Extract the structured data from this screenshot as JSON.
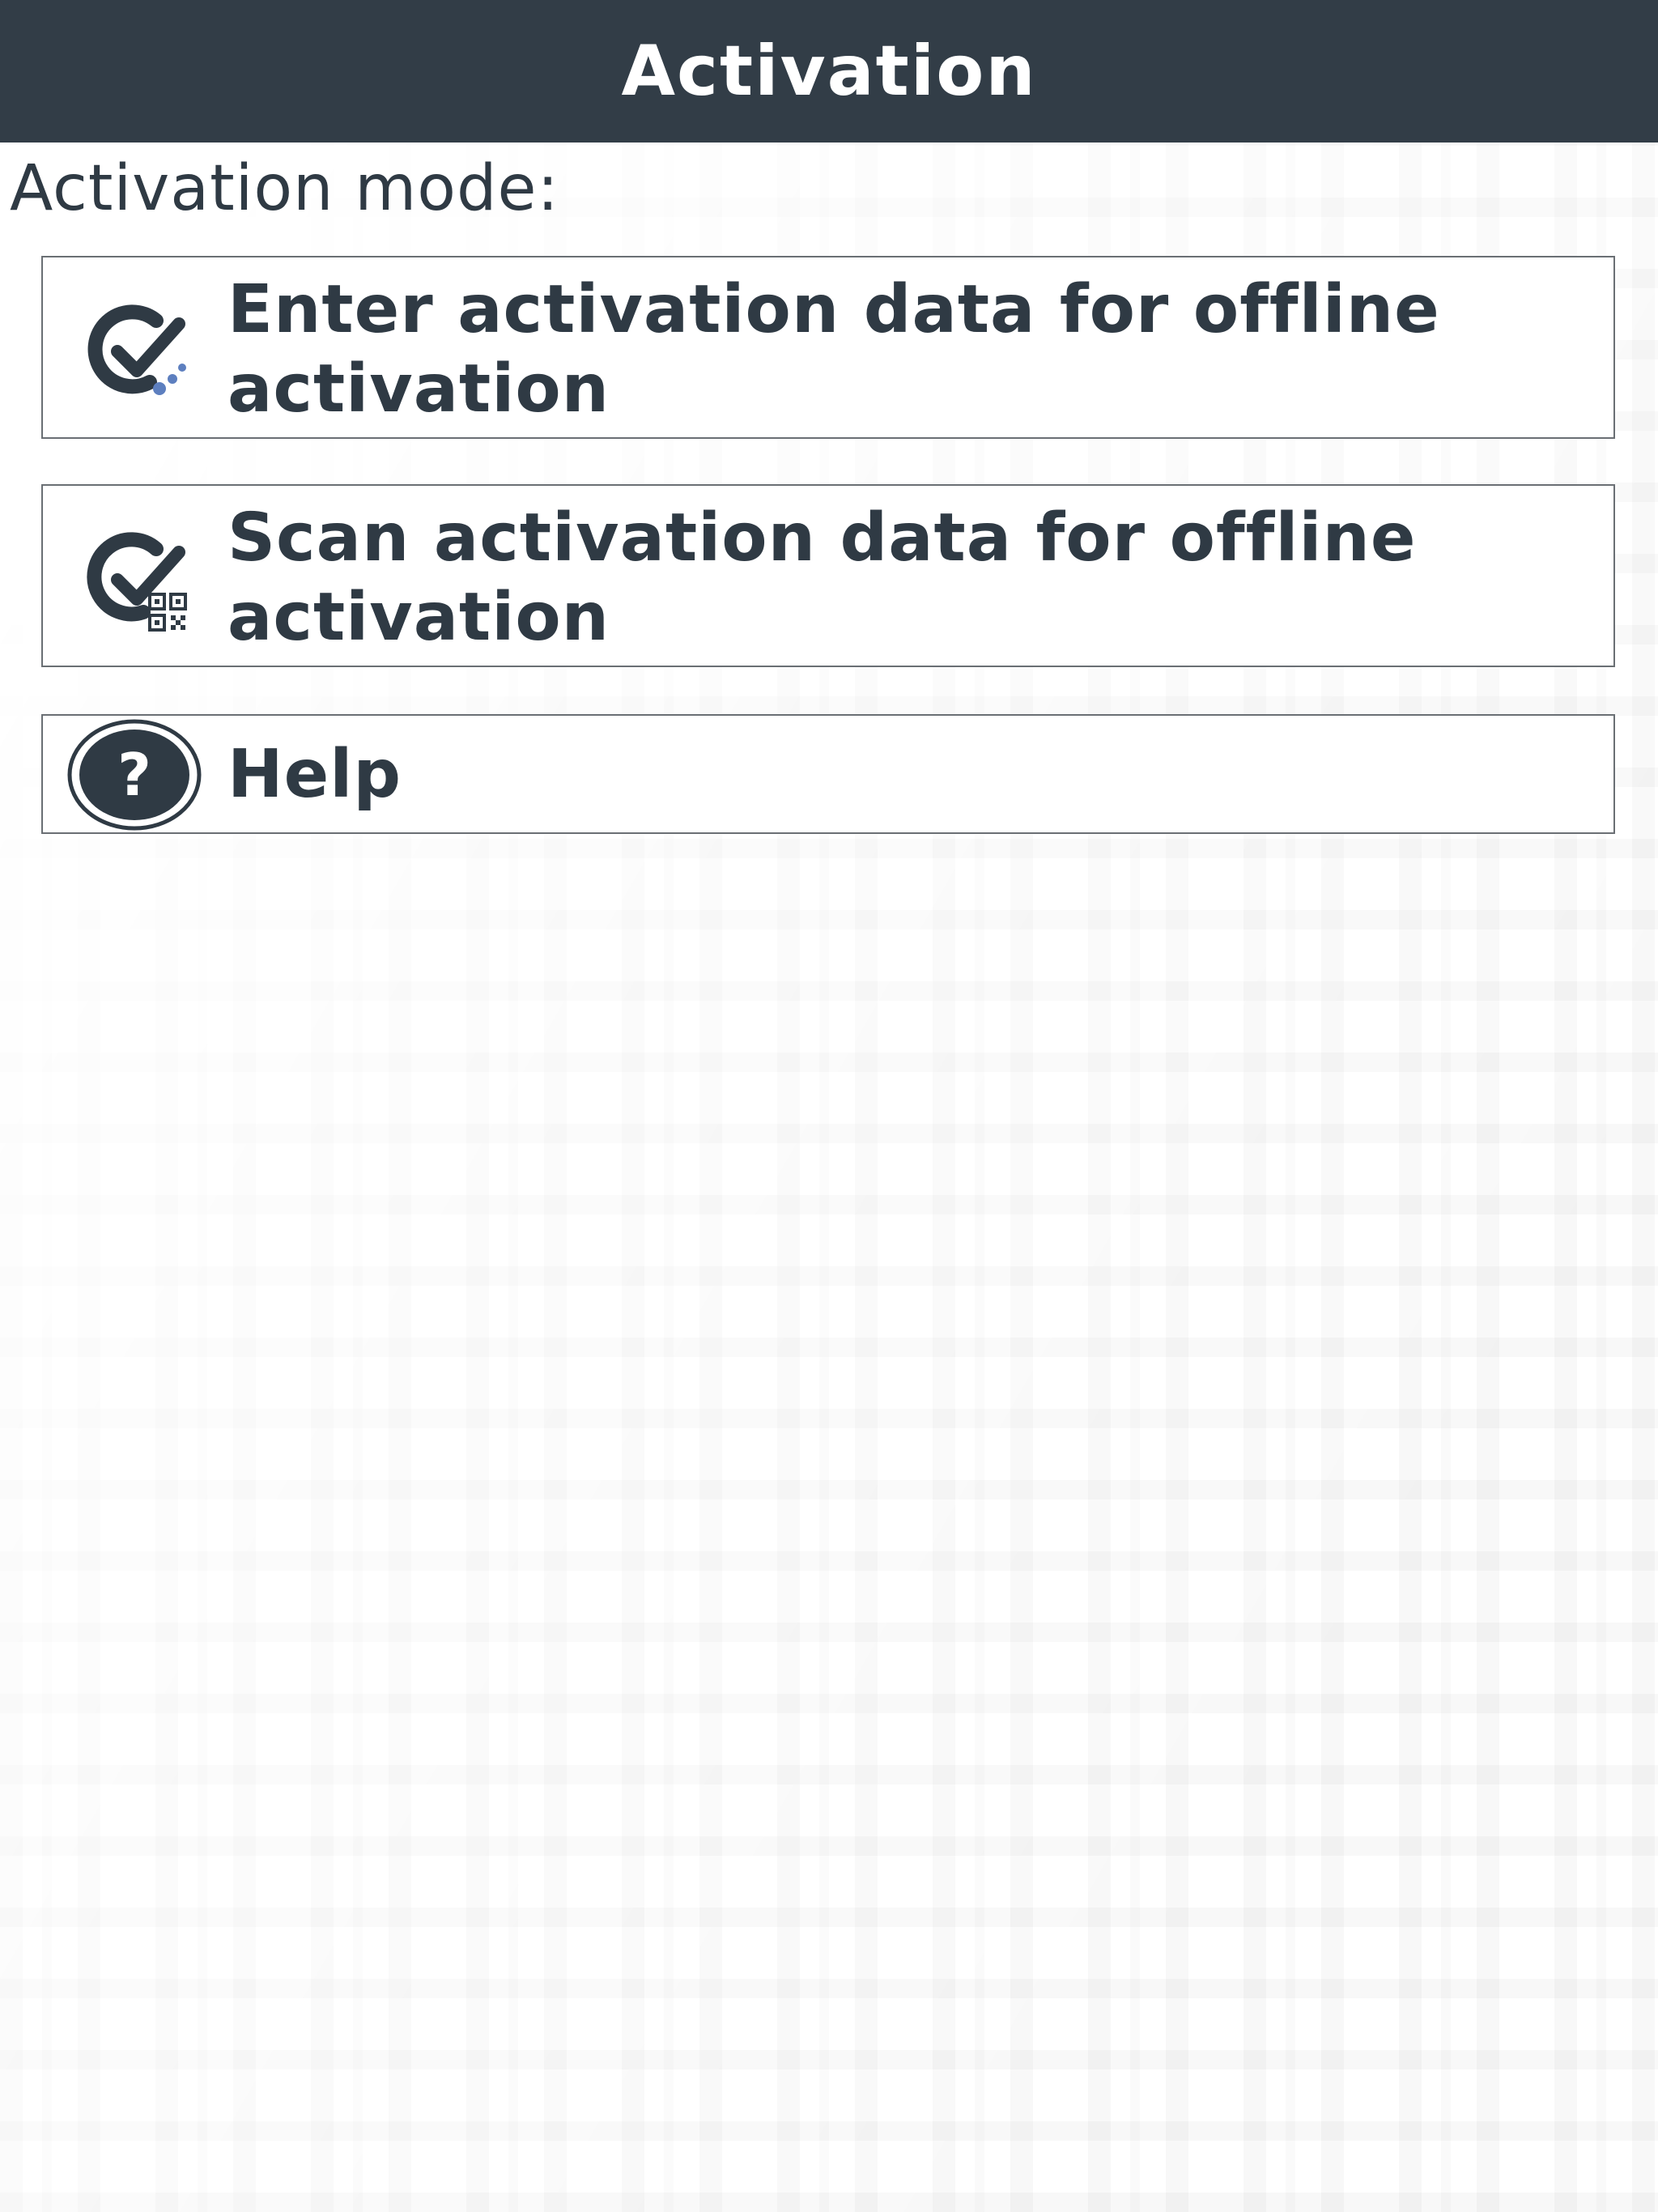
{
  "header": {
    "title": "Activation"
  },
  "main": {
    "mode_label": "Activation mode:",
    "options": [
      {
        "label": "Enter activation data for offline activation",
        "icon": "check-dots-icon"
      },
      {
        "label": "Scan activation data for offline activation",
        "icon": "check-qr-icon"
      },
      {
        "label": "Help",
        "icon": "help-circle-icon"
      }
    ]
  },
  "colors": {
    "header_bg": "#323d47",
    "text": "#2f3a44",
    "border": "#6a6f74"
  }
}
